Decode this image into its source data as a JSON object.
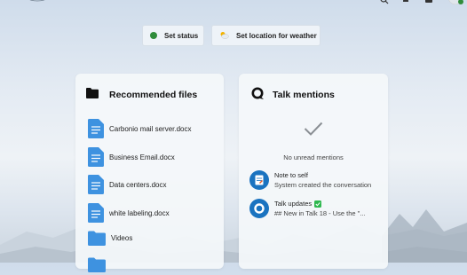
{
  "status_buttons": {
    "set_status": "Set status",
    "set_location": "Set location for weather"
  },
  "recommended": {
    "title": "Recommended files",
    "files": [
      {
        "name": "Carbonio mail server.docx",
        "icon": "document-icon"
      },
      {
        "name": "Business Email.docx",
        "icon": "document-icon"
      },
      {
        "name": "Data centers.docx",
        "icon": "document-icon"
      },
      {
        "name": "white labeling.docx",
        "icon": "document-icon"
      },
      {
        "name": "Videos",
        "icon": "folder-icon"
      }
    ]
  },
  "talk": {
    "title": "Talk mentions",
    "empty_text": "No unread mentions",
    "conversations": [
      {
        "name": "Note to self",
        "message": "System created the conversation"
      },
      {
        "name": "Talk updates",
        "message": "## New in Talk 18 - Use the \"..."
      }
    ]
  },
  "colors": {
    "accent": "#1a73c0",
    "file_icon": "#3e92e0",
    "status_green": "#2f8c3b",
    "card_bg": "#f4f7fa"
  }
}
